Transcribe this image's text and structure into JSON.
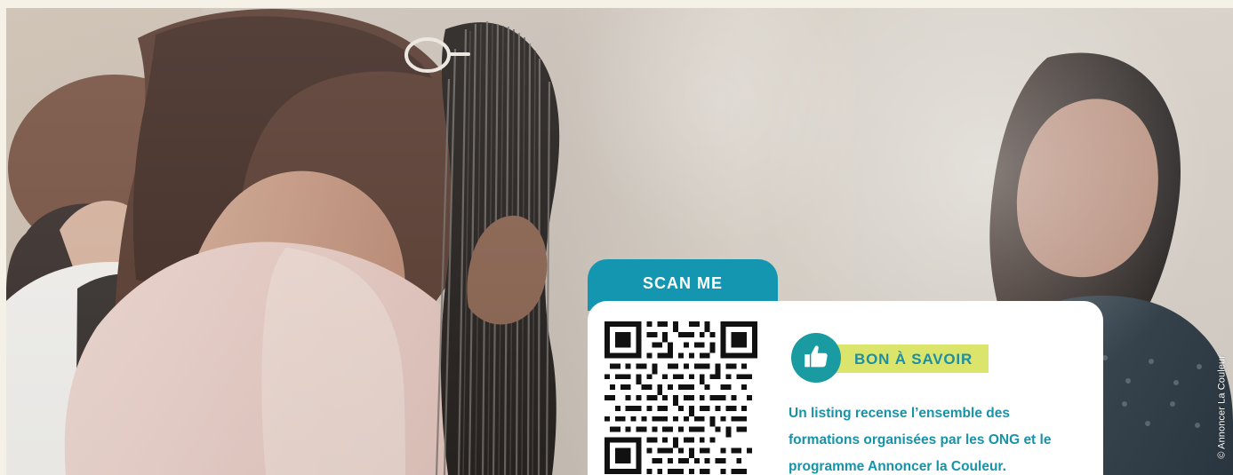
{
  "scan_section": {
    "label": "SCAN ME"
  },
  "info_box": {
    "title": "BON À SAVOIR",
    "body_line_1": "Un listing recense l’ensemble des",
    "body_line_2": "formations organisées par les ONG et le",
    "body_line_3": "programme Annoncer la Couleur."
  },
  "photo_credit": "© Annoncer La Couleur",
  "colors": {
    "teal_dark": "#1496b1",
    "teal_circle": "#1a9aa1",
    "accent_yellow": "#dbe56b",
    "text_teal": "#1693a8",
    "page_bg": "#f6f1e7"
  },
  "icons": {
    "hint_icon": "thumbs-up-icon",
    "qr_icon": "qr-code-icon"
  }
}
